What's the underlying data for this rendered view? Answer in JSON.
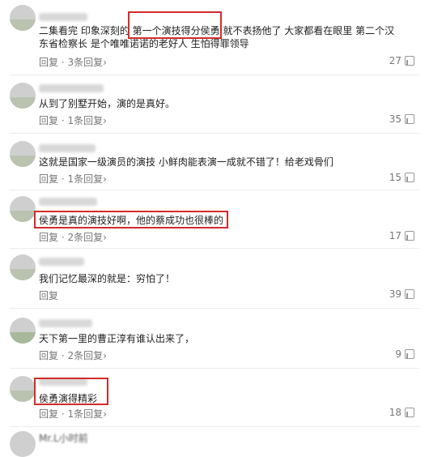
{
  "comments": [
    {
      "text": "二集看完 印象深刻的 第一个演技得分侯勇 就不表扬他了 大家都看在眼里 第二个汉东省检察长 是个唯唯诺诺的老好人 生怕得罪领导",
      "reply_label": "回复",
      "replies_label": "3条回复",
      "likes": "27"
    },
    {
      "text": "从到了别墅开始，演的是真好。",
      "reply_label": "回复",
      "replies_label": "1条回复",
      "likes": "35"
    },
    {
      "text": "这就是国家一级演员的演技 小鲜肉能表演一成就不错了！给老戏骨们",
      "reply_label": "回复",
      "replies_label": "1条回复",
      "likes": "15"
    },
    {
      "text": "侯勇是真的演技好啊，他的蔡成功也很棒的",
      "reply_label": "回复",
      "replies_label": "2条回复",
      "likes": "17"
    },
    {
      "text": "我们记忆最深的就是：穷怕了！",
      "reply_label": "回复",
      "replies_label": "",
      "likes": "39"
    },
    {
      "text": "天下第一里的曹正淳有谁认出来了，",
      "reply_label": "回复",
      "replies_label": "2条回复",
      "likes": "9"
    },
    {
      "text": "侯勇演得精彩",
      "reply_label": "回复",
      "replies_label": "1条回复",
      "likes": "18"
    }
  ],
  "next_user": "Mr.L小时前",
  "separator": " · "
}
